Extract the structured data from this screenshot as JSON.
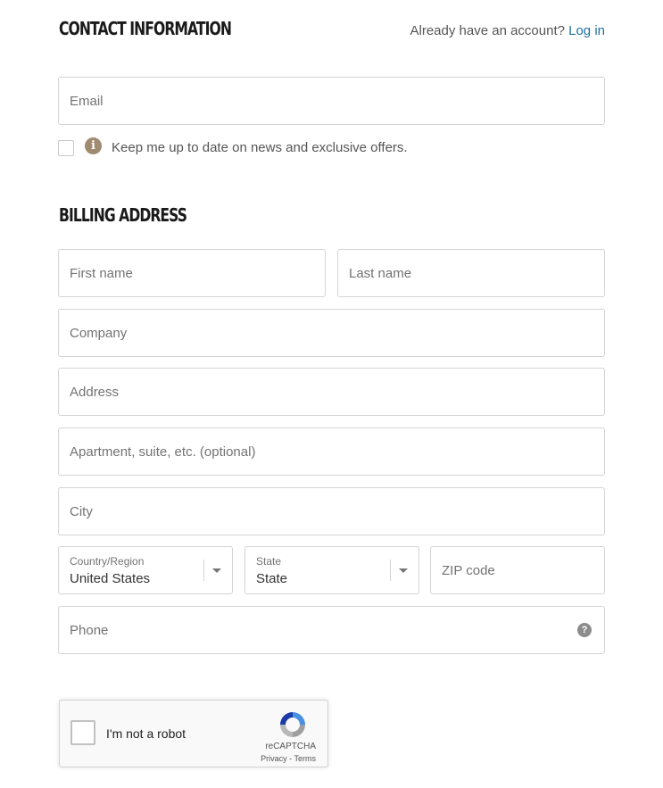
{
  "contact": {
    "title": "CONTACT INFORMATION",
    "account_prompt": "Already have an account?",
    "login_label": "Log in",
    "email_placeholder": "Email",
    "newsletter_label": "Keep me up to date on news and exclusive offers.",
    "newsletter_checked": false,
    "info_icon": "info-icon"
  },
  "billing": {
    "title": "BILLING ADDRESS",
    "first_name_placeholder": "First name",
    "last_name_placeholder": "Last name",
    "company_placeholder": "Company",
    "address_placeholder": "Address",
    "apartment_placeholder": "Apartment, suite, etc. (optional)",
    "city_placeholder": "City",
    "country": {
      "label": "Country/Region",
      "value": "United States"
    },
    "state": {
      "label": "State",
      "value": "State"
    },
    "zip_placeholder": "ZIP code",
    "phone_placeholder": "Phone",
    "phone_help_icon": "help-icon"
  },
  "recaptcha": {
    "label": "I'm not a robot",
    "brand": "reCAPTCHA",
    "terms": "Privacy - Terms",
    "checked": false
  },
  "colors": {
    "link": "#1f6fa1",
    "border": "#d4d4d4",
    "info_icon": "#a08a70"
  }
}
